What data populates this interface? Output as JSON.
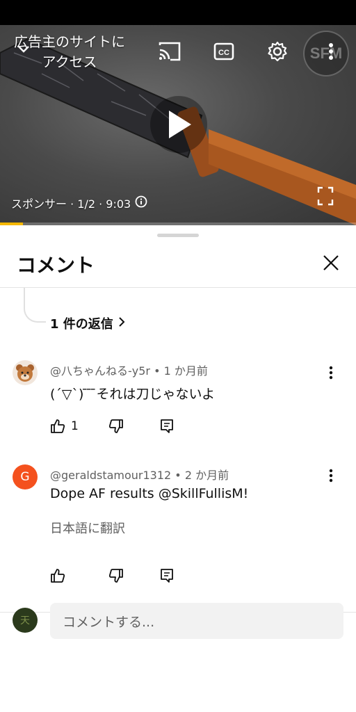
{
  "player": {
    "ad_cta": "広告主のサイトにアクセス",
    "channel_bug": "SFM",
    "sponsor_text": "スポンサー · 1/2 · 9:03",
    "progress": 0.065,
    "icons": [
      "chevron-down-icon",
      "cast-icon",
      "captions-icon",
      "settings-icon",
      "more-vert-icon",
      "play-icon",
      "info-icon",
      "fullscreen-icon"
    ]
  },
  "comments_panel": {
    "title": "コメント",
    "replies_link": "1 件の返信",
    "comments": [
      {
        "meta": "@八ちゃんねる-y5r • 1 か月前",
        "text": "(´▽`) ̄ ̄ ̄それは刀じゃないよ",
        "likes": "1",
        "avatar_letter": "",
        "avatar_color": "#f1e6dc"
      },
      {
        "meta": "@geraldstamour1312 • 2 か月前",
        "text": "Dope AF results @SkillFullisM!",
        "translate": "日本語に翻訳",
        "likes": "",
        "avatar_letter": "G",
        "avatar_color": "#f4511e"
      }
    ],
    "composer": {
      "placeholder": "コメントする...",
      "avatar_letter": "天"
    }
  }
}
